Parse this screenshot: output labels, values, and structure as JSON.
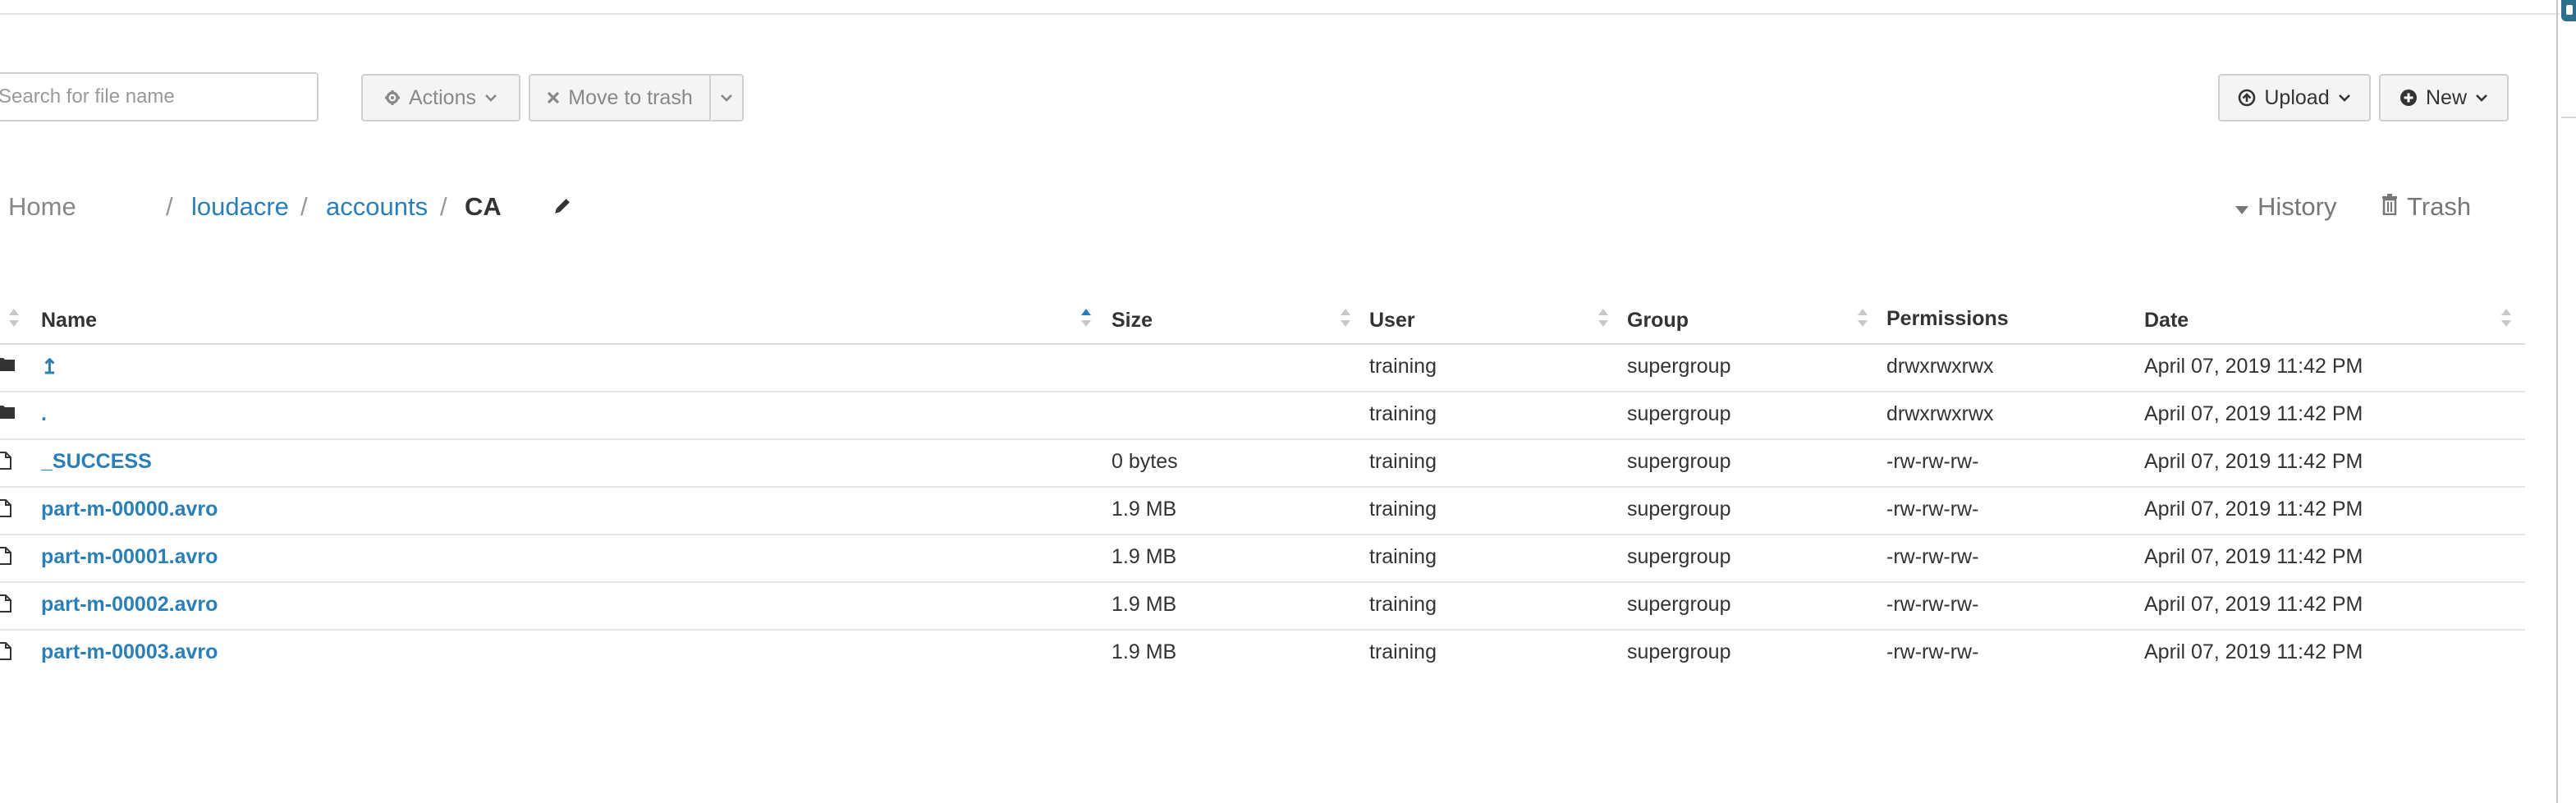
{
  "toolbar": {
    "search_placeholder": "Search for file name",
    "actions_label": "Actions",
    "move_to_trash_label": "Move to trash",
    "upload_label": "Upload",
    "new_label": "New"
  },
  "breadcrumb": {
    "home": "Home",
    "separator": "/",
    "links": [
      "loudacre",
      "accounts"
    ],
    "current": "CA"
  },
  "links": {
    "history": "History",
    "trash": "Trash"
  },
  "table": {
    "columns": [
      "Name",
      "Size",
      "User",
      "Group",
      "Permissions",
      "Date"
    ],
    "rows": [
      {
        "name": "↥",
        "size": "",
        "user": "training",
        "group": "supergroup",
        "permissions": "drwxrwxrwx",
        "date": "April 07, 2019 11:42 PM",
        "type": "folder"
      },
      {
        "name": ".",
        "size": "",
        "user": "training",
        "group": "supergroup",
        "permissions": "drwxrwxrwx",
        "date": "April 07, 2019 11:42 PM",
        "type": "folder"
      },
      {
        "name": "_SUCCESS",
        "size": "0 bytes",
        "user": "training",
        "group": "supergroup",
        "permissions": "-rw-rw-rw-",
        "date": "April 07, 2019 11:42 PM",
        "type": "file"
      },
      {
        "name": "part-m-00000.avro",
        "size": "1.9 MB",
        "user": "training",
        "group": "supergroup",
        "permissions": "-rw-rw-rw-",
        "date": "April 07, 2019 11:42 PM",
        "type": "file"
      },
      {
        "name": "part-m-00001.avro",
        "size": "1.9 MB",
        "user": "training",
        "group": "supergroup",
        "permissions": "-rw-rw-rw-",
        "date": "April 07, 2019 11:42 PM",
        "type": "file"
      },
      {
        "name": "part-m-00002.avro",
        "size": "1.9 MB",
        "user": "training",
        "group": "supergroup",
        "permissions": "-rw-rw-rw-",
        "date": "April 07, 2019 11:42 PM",
        "type": "file"
      },
      {
        "name": "part-m-00003.avro",
        "size": "1.9 MB",
        "user": "training",
        "group": "supergroup",
        "permissions": "-rw-rw-rw-",
        "date": "April 07, 2019 11:42 PM",
        "type": "file"
      }
    ]
  },
  "colors": {
    "link": "#2a7fb8",
    "sort_active": "#2a7fb8",
    "muted": "#888888"
  },
  "icons": [
    "gear-icon",
    "times-icon",
    "chevron-down-icon",
    "upload-circle-icon",
    "plus-circle-icon",
    "pencil-icon",
    "caret-down-icon",
    "trash-icon",
    "folder-icon",
    "file-icon",
    "sort-icon"
  ]
}
